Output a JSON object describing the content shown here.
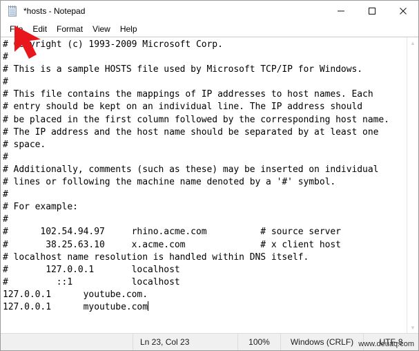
{
  "window": {
    "title": "*hosts - Notepad",
    "icon": "notepad-icon",
    "controls": {
      "minimize": "minimize-icon",
      "maximize": "maximize-icon",
      "close": "close-icon"
    }
  },
  "menubar": {
    "items": [
      {
        "label": "File"
      },
      {
        "label": "Edit"
      },
      {
        "label": "Format"
      },
      {
        "label": "View"
      },
      {
        "label": "Help"
      }
    ]
  },
  "editor": {
    "lines": [
      "# Copyright (c) 1993-2009 Microsoft Corp.",
      "#",
      "# This is a sample HOSTS file used by Microsoft TCP/IP for Windows.",
      "#",
      "# This file contains the mappings of IP addresses to host names. Each",
      "# entry should be kept on an individual line. The IP address should",
      "# be placed in the first column followed by the corresponding host name.",
      "# The IP address and the host name should be separated by at least one",
      "# space.",
      "#",
      "# Additionally, comments (such as these) may be inserted on individual",
      "# lines or following the machine name denoted by a '#' symbol.",
      "#",
      "# For example:",
      "#",
      "#      102.54.94.97     rhino.acme.com          # source server",
      "#       38.25.63.10     x.acme.com              # x client host",
      "",
      "# localhost name resolution is handled within DNS itself.",
      "#       127.0.0.1       localhost",
      "#         ::1           localhost",
      "127.0.0.1      youtube.com.",
      "127.0.0.1      myoutube.com"
    ],
    "caret_line_index": 22,
    "scrollbar": {
      "up_arrow": "chevron-up-icon",
      "down_arrow": "chevron-down-icon"
    }
  },
  "statusbar": {
    "cursor_position": "Ln 23, Col 23",
    "zoom": "100%",
    "line_ending": "Windows (CRLF)",
    "encoding": "UTF-8"
  },
  "overlay": {
    "watermark": "www.deuaq.com",
    "pointer": "red-arrow-cursor"
  },
  "colors": {
    "window_bg": "#ffffff",
    "text": "#000000",
    "statusbar_bg": "#f0f0f0",
    "border": "#dcdcdc",
    "pointer_red": "#e8171b"
  }
}
